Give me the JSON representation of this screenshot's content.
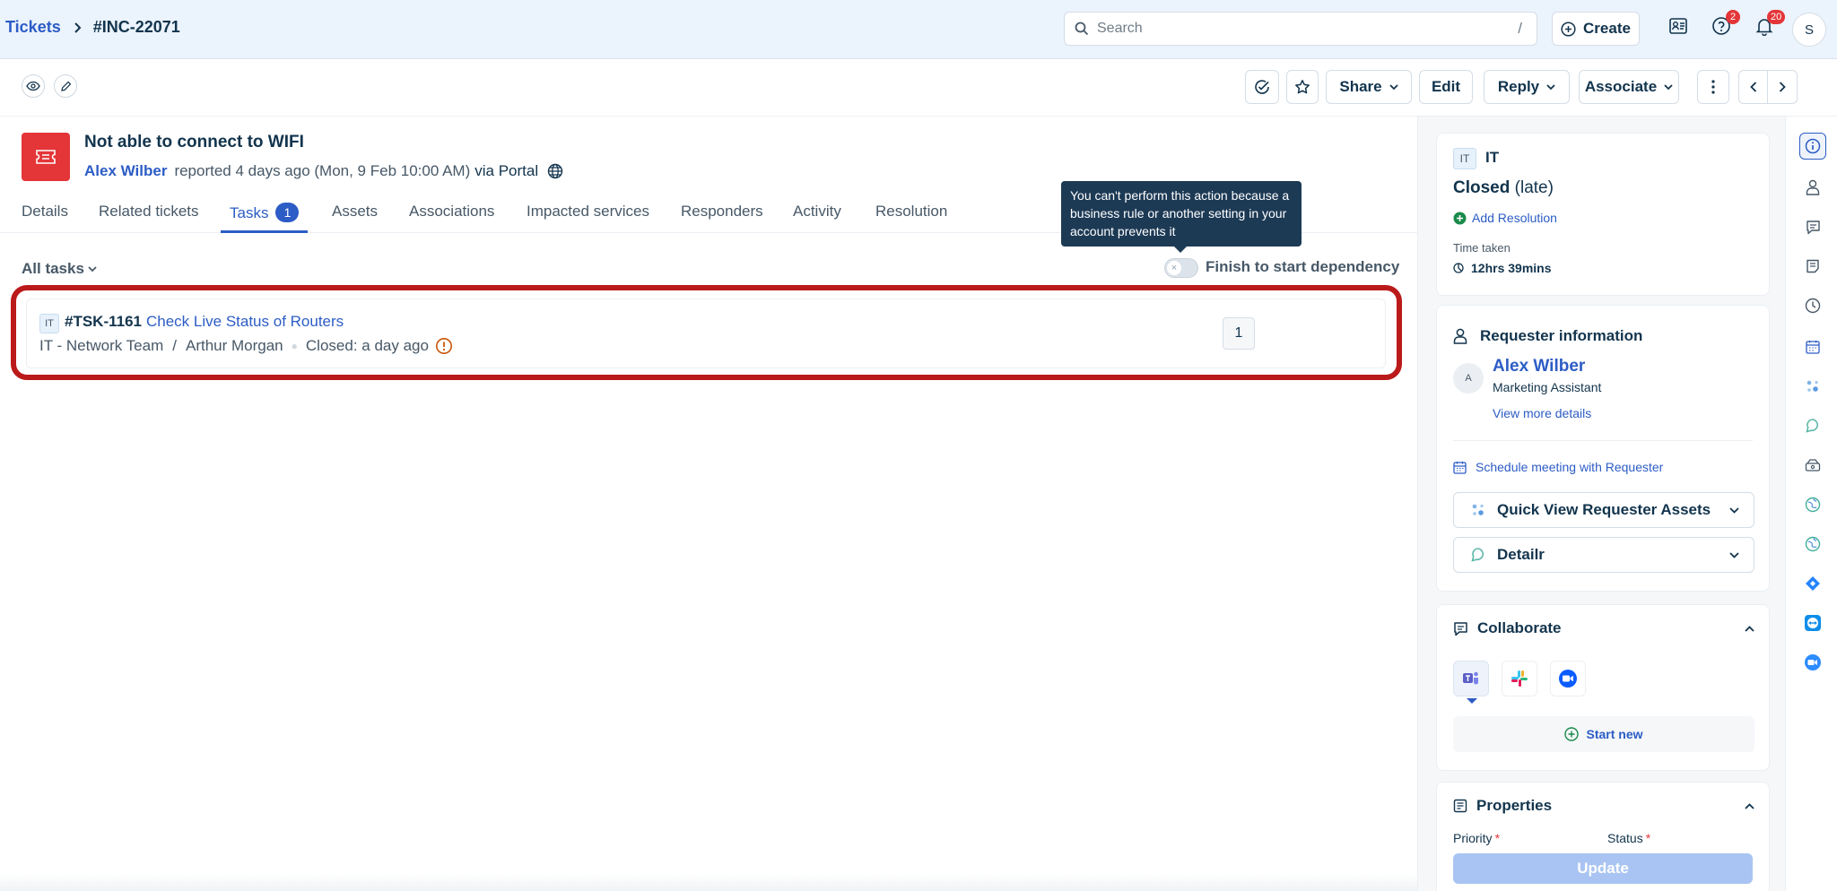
{
  "breadcrumb": {
    "root": "Tickets",
    "current": "#INC-22071"
  },
  "header": {
    "search_placeholder": "Search",
    "search_shortcut": "/",
    "create_label": "Create",
    "help_badge": "2",
    "notif_badge": "20",
    "user_initial": "S"
  },
  "toolbar": {
    "share": "Share",
    "edit": "Edit",
    "reply": "Reply",
    "associate": "Associate"
  },
  "ticket": {
    "title": "Not able to connect to WIFI",
    "requester": "Alex Wilber",
    "reported": "reported 4 days ago (Mon, 9 Feb 10:00 AM)",
    "via": "via Portal"
  },
  "tabs": [
    {
      "label": "Details"
    },
    {
      "label": "Related tickets"
    },
    {
      "label": "Tasks",
      "count": "1"
    },
    {
      "label": "Assets"
    },
    {
      "label": "Associations"
    },
    {
      "label": "Impacted services"
    },
    {
      "label": "Responders"
    },
    {
      "label": "Activity"
    },
    {
      "label": "Resolution"
    }
  ],
  "tooltip": "You can't perform this action because a business rule or another setting in your account prevents it",
  "tasks": {
    "filter": "All tasks",
    "dependency_label": "Finish to start dependency",
    "dependency_enabled": false,
    "items": [
      {
        "chip": "IT",
        "id": "#TSK-1161",
        "name": "Check Live Status of Routers",
        "group": "IT - Network Team",
        "agent": "Arthur Morgan",
        "closed": "Closed: a day ago",
        "count": "1"
      }
    ]
  },
  "summary": {
    "chip": "IT",
    "group": "IT",
    "status": "Closed",
    "status_note": "(late)",
    "add_resolution": "Add Resolution",
    "time_taken_label": "Time taken",
    "time_taken": "12hrs 39mins"
  },
  "requester": {
    "heading": "Requester information",
    "initial": "A",
    "name": "Alex Wilber",
    "role": "Marketing Assistant",
    "more": "View more details",
    "schedule": "Schedule meeting with Requester",
    "quick_view": "Quick View Requester Assets",
    "detailr": "Detailr"
  },
  "collaborate": {
    "heading": "Collaborate",
    "start_new": "Start new"
  },
  "properties": {
    "heading": "Properties",
    "priority": "Priority",
    "status": "Status",
    "required_mark": "*",
    "update": "Update"
  },
  "colors": {
    "accent": "#2c5cc5",
    "danger": "#e43538",
    "highlight": "#bb1a1a",
    "tooltip_bg": "#1d3a55"
  }
}
